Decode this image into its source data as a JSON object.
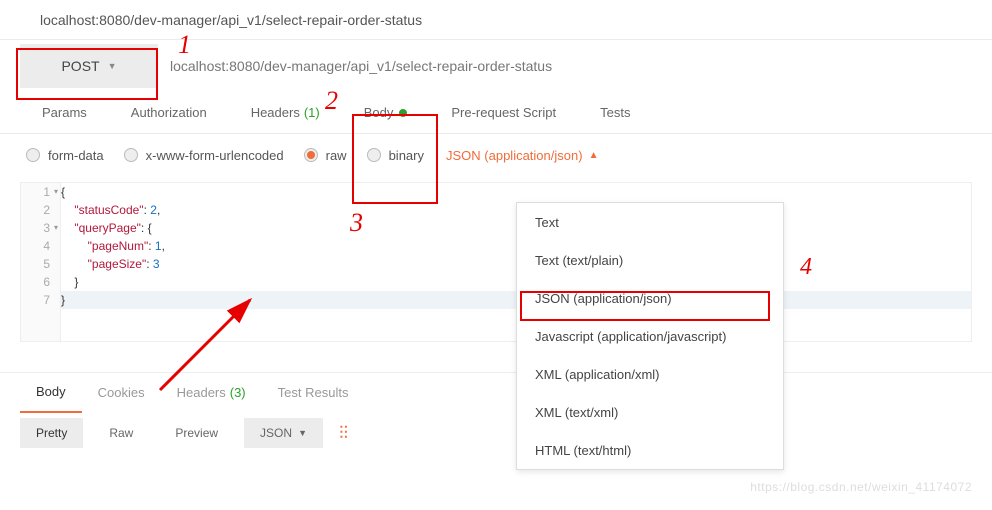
{
  "tab_title": "localhost:8080/dev-manager/api_v1/select-repair-order-status",
  "method": "POST",
  "url": "localhost:8080/dev-manager/api_v1/select-repair-order-status",
  "request_tabs": {
    "params": "Params",
    "auth": "Authorization",
    "headers": "Headers",
    "headers_count": "(1)",
    "body": "Body",
    "prerequest": "Pre-request Script",
    "tests": "Tests"
  },
  "body_options": {
    "form_data": "form-data",
    "urlencoded": "x-www-form-urlencoded",
    "raw": "raw",
    "binary": "binary"
  },
  "content_type_selected": "JSON (application/json)",
  "content_type_options": [
    "Text",
    "Text (text/plain)",
    "JSON (application/json)",
    "Javascript (application/javascript)",
    "XML (application/xml)",
    "XML (text/xml)",
    "HTML (text/html)"
  ],
  "editor": {
    "lines": [
      {
        "n": "1",
        "fold": true,
        "parts": [
          {
            "t": "{",
            "c": "pun"
          }
        ]
      },
      {
        "n": "2",
        "fold": false,
        "parts": [
          {
            "t": "    ",
            "c": ""
          },
          {
            "t": "\"statusCode\"",
            "c": "str"
          },
          {
            "t": ": ",
            "c": "pun"
          },
          {
            "t": "2",
            "c": "num"
          },
          {
            "t": ",",
            "c": "pun"
          }
        ]
      },
      {
        "n": "3",
        "fold": true,
        "parts": [
          {
            "t": "    ",
            "c": ""
          },
          {
            "t": "\"queryPage\"",
            "c": "str"
          },
          {
            "t": ": {",
            "c": "pun"
          }
        ]
      },
      {
        "n": "4",
        "fold": false,
        "parts": [
          {
            "t": "        ",
            "c": ""
          },
          {
            "t": "\"pageNum\"",
            "c": "str"
          },
          {
            "t": ": ",
            "c": "pun"
          },
          {
            "t": "1",
            "c": "num"
          },
          {
            "t": ",",
            "c": "pun"
          }
        ]
      },
      {
        "n": "5",
        "fold": false,
        "parts": [
          {
            "t": "        ",
            "c": ""
          },
          {
            "t": "\"pageSize\"",
            "c": "str"
          },
          {
            "t": ": ",
            "c": "pun"
          },
          {
            "t": "3",
            "c": "num"
          }
        ]
      },
      {
        "n": "6",
        "fold": false,
        "parts": [
          {
            "t": "    }",
            "c": "pun"
          }
        ]
      },
      {
        "n": "7",
        "fold": false,
        "parts": [
          {
            "t": "}",
            "c": "pun"
          }
        ],
        "hl": true
      }
    ]
  },
  "response_tabs": {
    "body": "Body",
    "cookies": "Cookies",
    "headers": "Headers",
    "headers_count": "(3)",
    "test_results": "Test Results"
  },
  "response_toolbar": {
    "pretty": "Pretty",
    "raw": "Raw",
    "preview": "Preview",
    "json": "JSON"
  },
  "annotations": {
    "n1": "1",
    "n2": "2",
    "n3": "3",
    "n4": "4"
  },
  "watermark": "https://blog.csdn.net/weixin_41174072"
}
